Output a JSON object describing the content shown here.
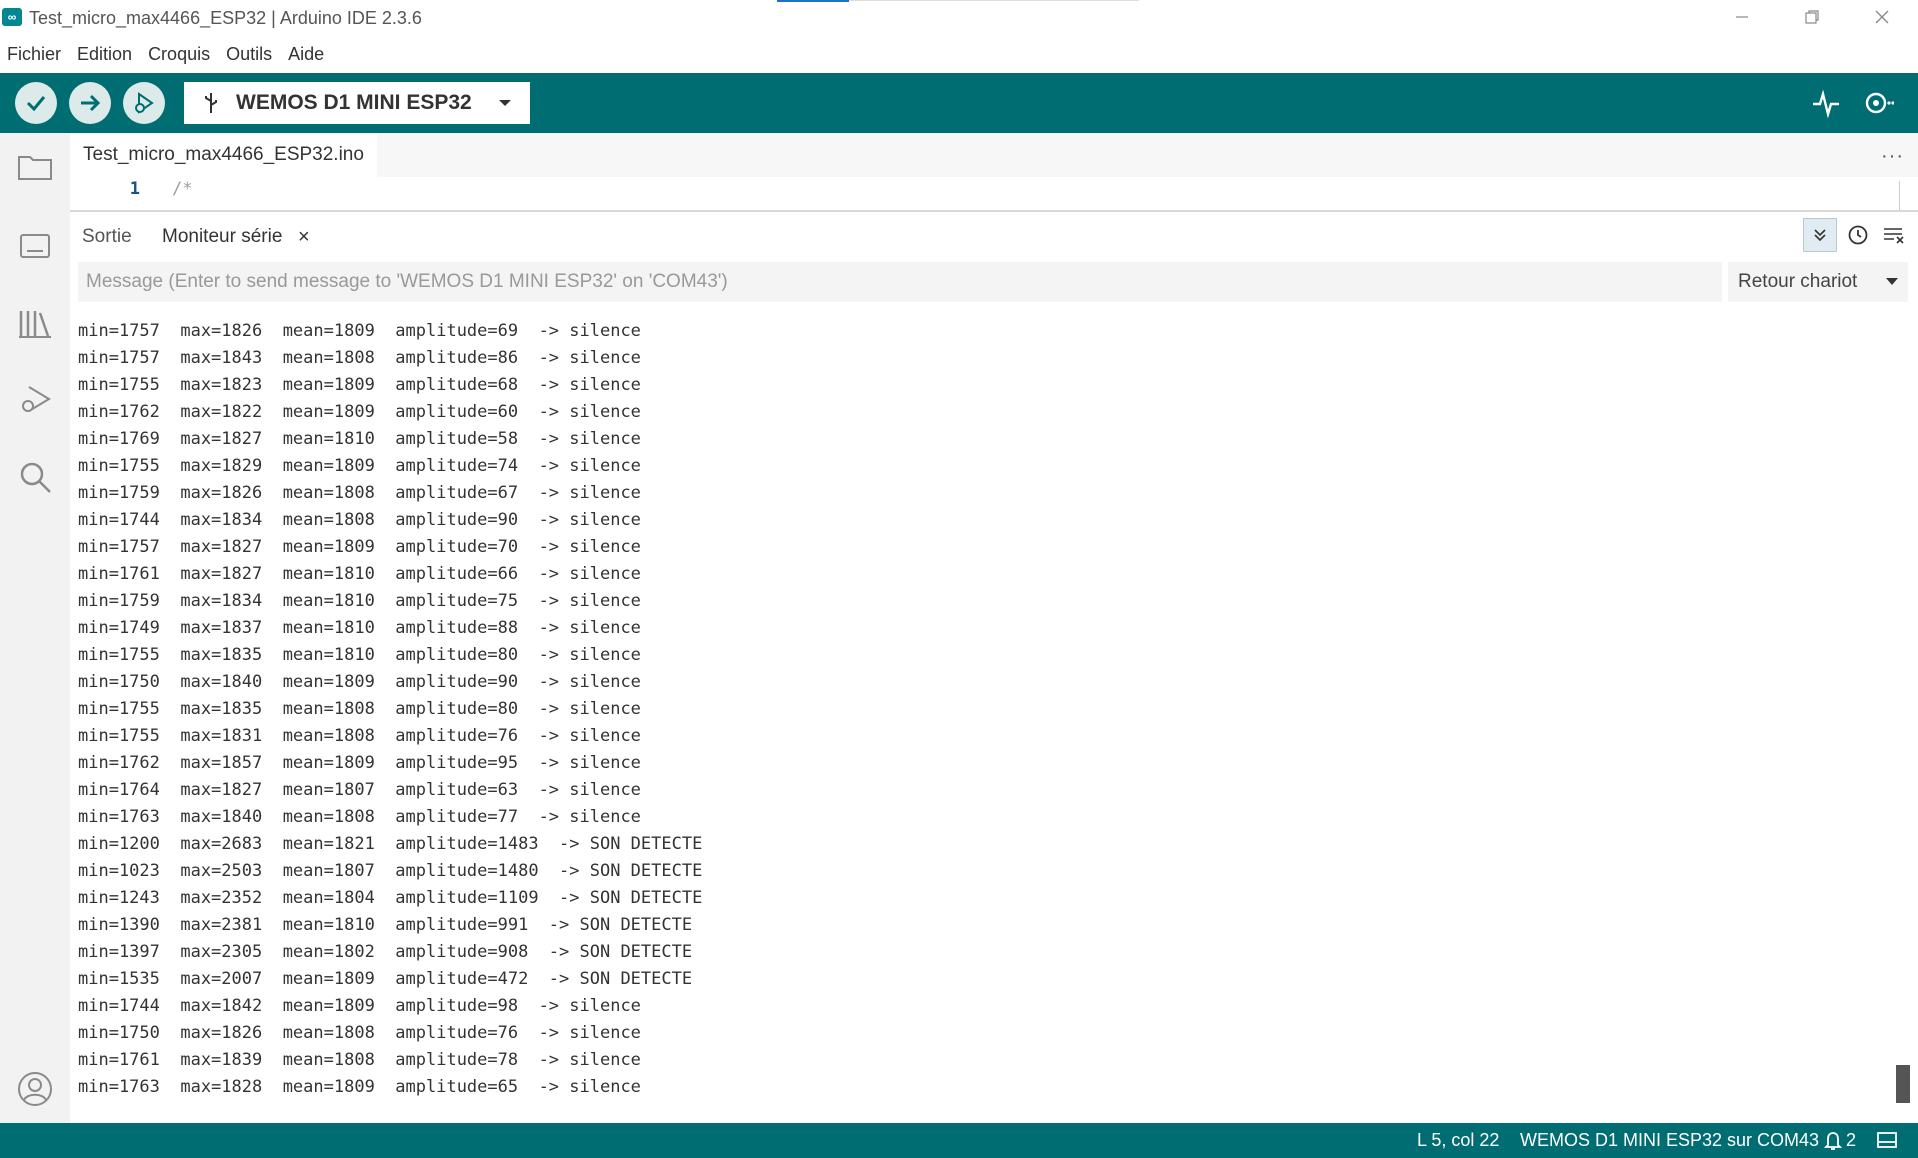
{
  "window": {
    "title": "Test_micro_max4466_ESP32 | Arduino IDE 2.3.6",
    "app_icon": "∞"
  },
  "menu": {
    "items": [
      "Fichier",
      "Edition",
      "Croquis",
      "Outils",
      "Aide"
    ]
  },
  "toolbar": {
    "board_name": "WEMOS D1 MINI ESP32",
    "accent_color": "#006d72"
  },
  "editor": {
    "file_tab": "Test_micro_max4466_ESP32.ino",
    "more": "···",
    "line_number": "1",
    "code_line": "/*"
  },
  "panel": {
    "tab_output": "Sortie",
    "tab_serial": "Moniteur série",
    "close": "×",
    "message_placeholder": "Message (Enter to send message to 'WEMOS D1 MINI ESP32' on 'COM43')",
    "line_ending": "Retour chariot"
  },
  "serial_lines": [
    "min=1757  max=1826  mean=1809  amplitude=69  -> silence",
    "min=1757  max=1843  mean=1808  amplitude=86  -> silence",
    "min=1755  max=1823  mean=1809  amplitude=68  -> silence",
    "min=1762  max=1822  mean=1809  amplitude=60  -> silence",
    "min=1769  max=1827  mean=1810  amplitude=58  -> silence",
    "min=1755  max=1829  mean=1809  amplitude=74  -> silence",
    "min=1759  max=1826  mean=1808  amplitude=67  -> silence",
    "min=1744  max=1834  mean=1808  amplitude=90  -> silence",
    "min=1757  max=1827  mean=1809  amplitude=70  -> silence",
    "min=1761  max=1827  mean=1810  amplitude=66  -> silence",
    "min=1759  max=1834  mean=1810  amplitude=75  -> silence",
    "min=1749  max=1837  mean=1810  amplitude=88  -> silence",
    "min=1755  max=1835  mean=1810  amplitude=80  -> silence",
    "min=1750  max=1840  mean=1809  amplitude=90  -> silence",
    "min=1755  max=1835  mean=1808  amplitude=80  -> silence",
    "min=1755  max=1831  mean=1808  amplitude=76  -> silence",
    "min=1762  max=1857  mean=1809  amplitude=95  -> silence",
    "min=1764  max=1827  mean=1807  amplitude=63  -> silence",
    "min=1763  max=1840  mean=1808  amplitude=77  -> silence",
    "min=1200  max=2683  mean=1821  amplitude=1483  -> SON DETECTE",
    "min=1023  max=2503  mean=1807  amplitude=1480  -> SON DETECTE",
    "min=1243  max=2352  mean=1804  amplitude=1109  -> SON DETECTE",
    "min=1390  max=2381  mean=1810  amplitude=991  -> SON DETECTE",
    "min=1397  max=2305  mean=1802  amplitude=908  -> SON DETECTE",
    "min=1535  max=2007  mean=1809  amplitude=472  -> SON DETECTE",
    "min=1744  max=1842  mean=1809  amplitude=98  -> silence",
    "min=1750  max=1826  mean=1808  amplitude=76  -> silence",
    "min=1761  max=1839  mean=1808  amplitude=78  -> silence",
    "min=1763  max=1828  mean=1809  amplitude=65  -> silence"
  ],
  "status": {
    "cursor": "L 5, col 22",
    "board_port": "WEMOS D1 MINI ESP32 sur COM43",
    "notifications": "2"
  },
  "icons": {
    "verify": "check-icon",
    "upload": "arrow-right-icon",
    "debug": "debug-icon",
    "plotter": "serial-plotter-icon",
    "monitor": "serial-monitor-icon"
  }
}
